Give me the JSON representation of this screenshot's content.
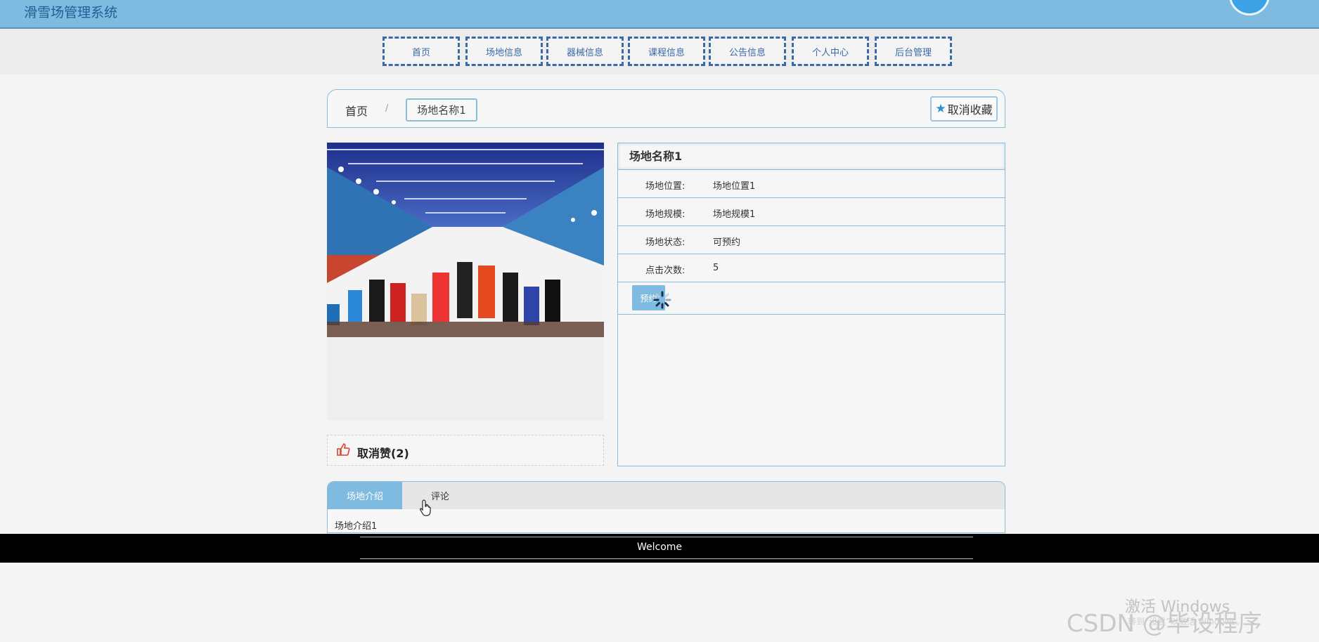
{
  "header": {
    "app_title": "滑雪场管理系统"
  },
  "nav": {
    "items": [
      {
        "label": "首页"
      },
      {
        "label": "场地信息"
      },
      {
        "label": "器械信息"
      },
      {
        "label": "课程信息"
      },
      {
        "label": "公告信息"
      },
      {
        "label": "个人中心"
      },
      {
        "label": "后台管理"
      }
    ]
  },
  "breadcrumb": {
    "home": "首页",
    "separator": "/",
    "current": "场地名称1"
  },
  "favorite": {
    "label": "取消收藏",
    "icon": "star-icon"
  },
  "like": {
    "label": "取消赞(2)",
    "icon": "thumbs-up-icon"
  },
  "detail": {
    "title": "场地名称1",
    "rows": [
      {
        "label": "场地位置:",
        "value": "场地位置1"
      },
      {
        "label": "场地规模:",
        "value": "场地规模1"
      },
      {
        "label": "场地状态:",
        "value": "可预约"
      },
      {
        "label": "点击次数:",
        "value": "5"
      }
    ],
    "book_label": "预约"
  },
  "tabs": {
    "items": [
      {
        "label": "场地介绍"
      },
      {
        "label": "评论"
      }
    ],
    "active": 0,
    "content": "场地介绍1"
  },
  "footer": {
    "text": "Welcome"
  },
  "watermark": {
    "activate": "激活 Windows",
    "activate_sub": "转到“设置”以激活 Windows。",
    "csdn": "CSDN @毕设程序"
  },
  "colors": {
    "accent": "#7fbbe0",
    "nav_border": "#3b6aa8",
    "panel_border": "#8cbcd6"
  }
}
